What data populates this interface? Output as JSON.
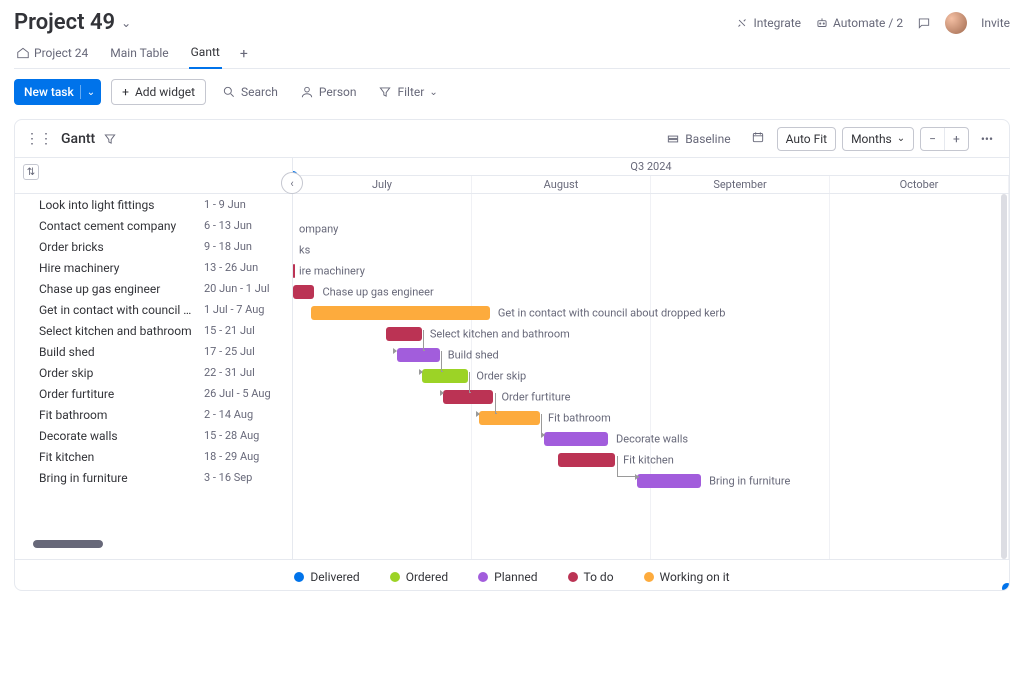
{
  "header": {
    "title": "Project 49",
    "integrate": "Integrate",
    "automate": "Automate / 2",
    "invite": "Invite"
  },
  "tabs": [
    {
      "label": "Project 24",
      "icon": "home"
    },
    {
      "label": "Main Table"
    },
    {
      "label": "Gantt",
      "active": true
    }
  ],
  "toolbar": {
    "new_task": "New task",
    "add_widget": "Add widget",
    "search": "Search",
    "person": "Person",
    "filter": "Filter"
  },
  "gantt_header": {
    "title": "Gantt",
    "baseline": "Baseline",
    "autofit": "Auto Fit",
    "timescale": "Months"
  },
  "timeline": {
    "quarter": "Q3 2024",
    "months": [
      "July",
      "August",
      "September",
      "October"
    ]
  },
  "legend": [
    {
      "label": "Delivered",
      "color": "#0073ea"
    },
    {
      "label": "Ordered",
      "color": "#9cd326"
    },
    {
      "label": "Planned",
      "color": "#a25ddc"
    },
    {
      "label": "To do",
      "color": "#bb3354"
    },
    {
      "label": "Working on it",
      "color": "#fdab3d"
    }
  ],
  "chart_data": {
    "type": "bar",
    "orientation": "horizontal-gantt",
    "x_unit": "percent-of-visible-range",
    "visible_range_start": "late-June-2024",
    "months": [
      "July",
      "August",
      "September",
      "October"
    ],
    "tasks": [
      {
        "name": "Look into light fittings",
        "date_label": "1 - 9 Jun",
        "bar": null,
        "clip_label": null
      },
      {
        "name": "Contact cement company",
        "date_label": "6 - 13 Jun",
        "bar": null,
        "clip_label": "ompany"
      },
      {
        "name": "Order bricks",
        "date_label": "9 - 18 Jun",
        "bar": null,
        "clip_label": "ks"
      },
      {
        "name": "Hire machinery",
        "date_label": "13 - 26 Jun",
        "bar": {
          "start": 0,
          "width": 0.3,
          "color": "#bb3354"
        },
        "clip_label": "ire machinery"
      },
      {
        "name": "Chase up gas engineer",
        "date_label": "20 Jun - 1 Jul",
        "bar": {
          "start": 0,
          "width": 3,
          "color": "#bb3354"
        },
        "label_after": "Chase up gas engineer"
      },
      {
        "name": "Get in contact with council ab..",
        "date_label": "1 Jul - 7 Aug",
        "bar": {
          "start": 2.5,
          "width": 25,
          "color": "#fdab3d"
        },
        "label_after": "Get in contact with council about dropped kerb"
      },
      {
        "name": "Select kitchen and bathroom",
        "date_label": "15 - 21 Jul",
        "bar": {
          "start": 13,
          "width": 5,
          "color": "#bb3354"
        },
        "label_after": "Select kitchen and bathroom"
      },
      {
        "name": "Build shed",
        "date_label": "17 - 25 Jul",
        "bar": {
          "start": 14.5,
          "width": 6,
          "color": "#a25ddc"
        },
        "label_after": "Build shed",
        "dep_from": 6
      },
      {
        "name": "Order skip",
        "date_label": "22 - 31 Jul",
        "bar": {
          "start": 18,
          "width": 6.5,
          "color": "#9cd326"
        },
        "label_after": "Order skip",
        "dep_from": 7
      },
      {
        "name": "Order furtiture",
        "date_label": "26 Jul - 5 Aug",
        "bar": {
          "start": 21,
          "width": 7,
          "color": "#bb3354"
        },
        "label_after": "Order furtiture",
        "dep_from": 8
      },
      {
        "name": "Fit bathroom",
        "date_label": "2 - 14 Aug",
        "bar": {
          "start": 26,
          "width": 8.5,
          "color": "#fdab3d"
        },
        "label_after": "Fit bathroom",
        "dep_from": 9
      },
      {
        "name": "Decorate walls",
        "date_label": "15 - 28 Aug",
        "bar": {
          "start": 35,
          "width": 9,
          "color": "#a25ddc"
        },
        "label_after": "Decorate walls",
        "dep_from": 10
      },
      {
        "name": "Fit kitchen",
        "date_label": "18 - 29 Aug",
        "bar": {
          "start": 37,
          "width": 8,
          "color": "#bb3354"
        },
        "label_after": "Fit kitchen"
      },
      {
        "name": "Bring in furniture",
        "date_label": "3 - 16 Sep",
        "bar": {
          "start": 48,
          "width": 9,
          "color": "#a25ddc"
        },
        "label_after": "Bring in furniture",
        "dep_from": 12
      }
    ]
  }
}
